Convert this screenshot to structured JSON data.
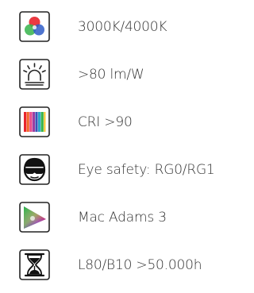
{
  "features": [
    {
      "icon": "rgb-color-circles-icon",
      "label": "3000K/4000K"
    },
    {
      "icon": "light-beam-icon",
      "label": ">80  lm/W"
    },
    {
      "icon": "color-spectrum-bars-icon",
      "label": "CRI >90"
    },
    {
      "icon": "face-with-goggles-icon",
      "label": "Eye safety: RG0/RG1"
    },
    {
      "icon": "chromaticity-triangle-icon",
      "label": "Mac Adams 3"
    },
    {
      "icon": "hourglass-icon",
      "label": "L80/B10 >50.000h"
    }
  ]
}
